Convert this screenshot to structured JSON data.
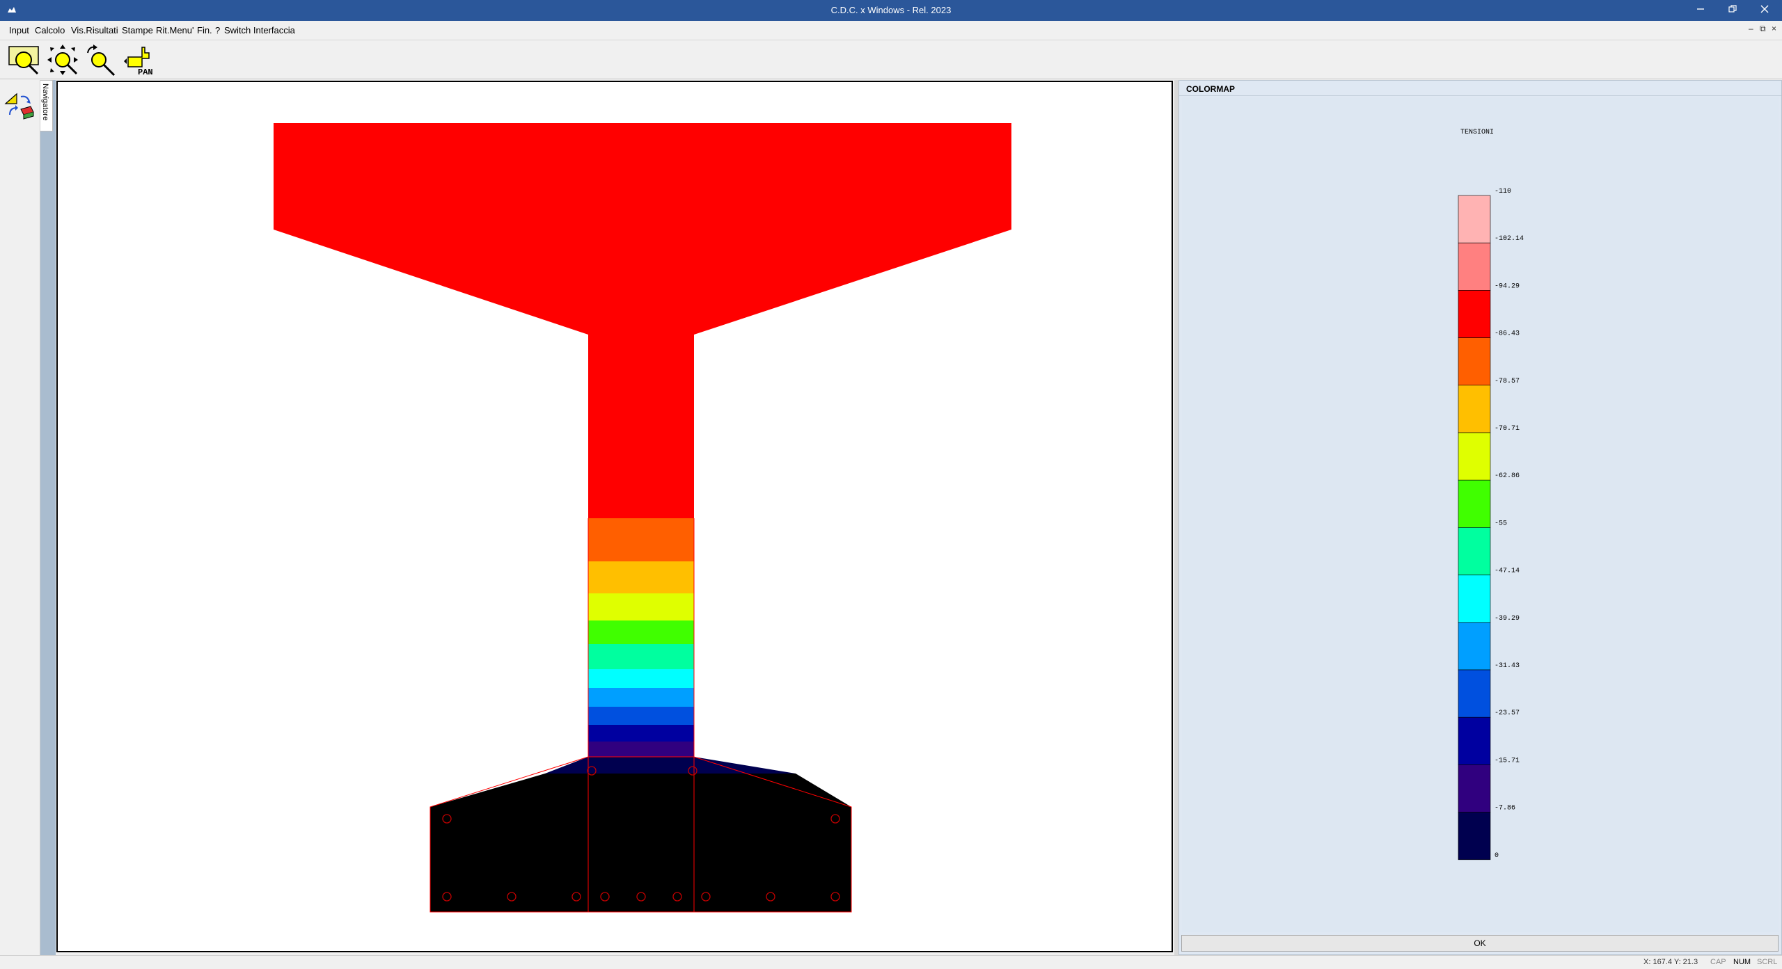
{
  "window": {
    "title": "C.D.C. x Windows - Rel. 2023"
  },
  "menu": {
    "items": [
      "Input",
      "Calcolo",
      "Vis.Risultati",
      "Stampe",
      "Rit.Menu'",
      "Fin.",
      "?",
      "Switch Interfaccia"
    ]
  },
  "toolbar": {
    "pan_label": "PAN"
  },
  "nav_tab": {
    "label": "Navigatore"
  },
  "colormap_panel": {
    "header": "COLORMAP",
    "title": "TENSIONI",
    "ok_label": "OK",
    "scale_labels": [
      "-110",
      "-102.14",
      "-94.29",
      "-86.43",
      "-78.57",
      "-70.71",
      "-62.86",
      "-55",
      "-47.14",
      "-39.29",
      "-31.43",
      "-23.57",
      "-15.71",
      "-7.86",
      "0"
    ],
    "colors": [
      "#FFB3B3",
      "#FF8080",
      "#FF0000",
      "#FF5F00",
      "#FFBF00",
      "#DFFF00",
      "#40FF00",
      "#00FF9F",
      "#00FFFF",
      "#009FFF",
      "#0050DF",
      "#0000A0",
      "#30007F",
      "#00004F"
    ]
  },
  "section": {
    "stress_band_colors": [
      "#FF5F00",
      "#FFBF00",
      "#DFFF00",
      "#40FF00",
      "#00FF9F",
      "#00FFFF",
      "#009FFF",
      "#0050DF",
      "#0000A0",
      "#30007F",
      "#00004F"
    ],
    "compressed_color": "#FF0000",
    "tension_zone_color": "#000000",
    "rebar_color": "#C00000"
  },
  "status": {
    "coords": "X: 167.4  Y: 21.3",
    "cap": "CAP",
    "num": "NUM",
    "scrl": "SCRL"
  }
}
